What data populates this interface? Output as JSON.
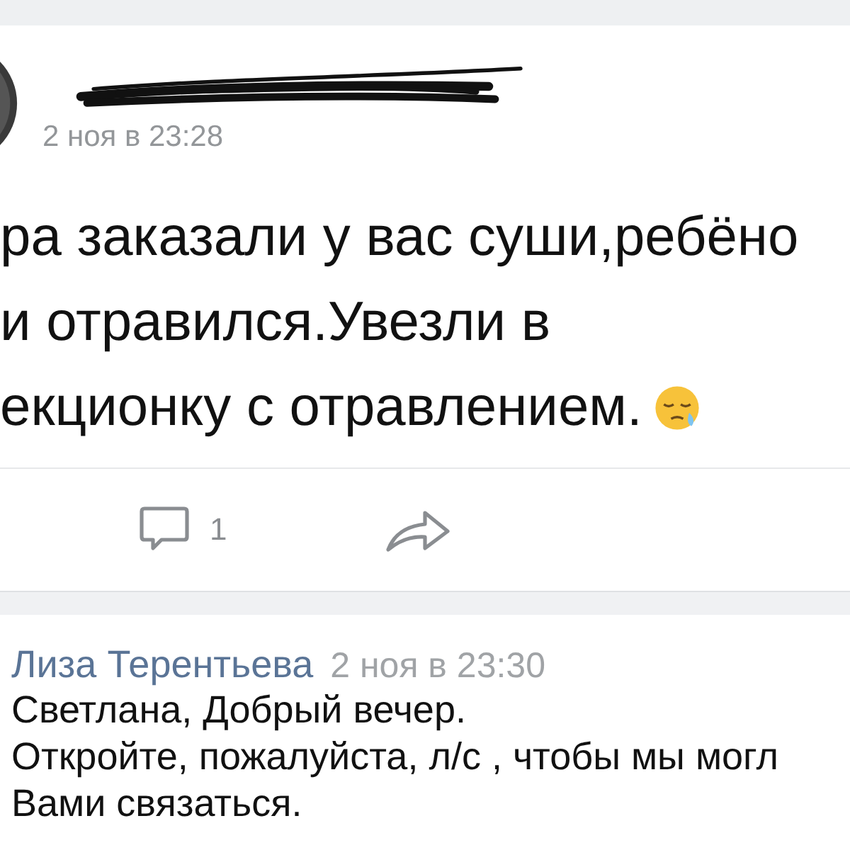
{
  "post": {
    "date": "2 ноя в 23:28",
    "lines": [
      "ра заказали у вас суши,ребёно",
      "и отравился.Увезли в",
      "екционку с отравлением."
    ],
    "comment_count": "1"
  },
  "comment": {
    "author": "Лиза Терентьева",
    "date": "2 ноя в 23:30",
    "lines": [
      "Светлана, Добрый вечер.",
      "Откройте, пожалуйста, л/с , чтобы мы могл",
      "Вами связаться."
    ]
  }
}
